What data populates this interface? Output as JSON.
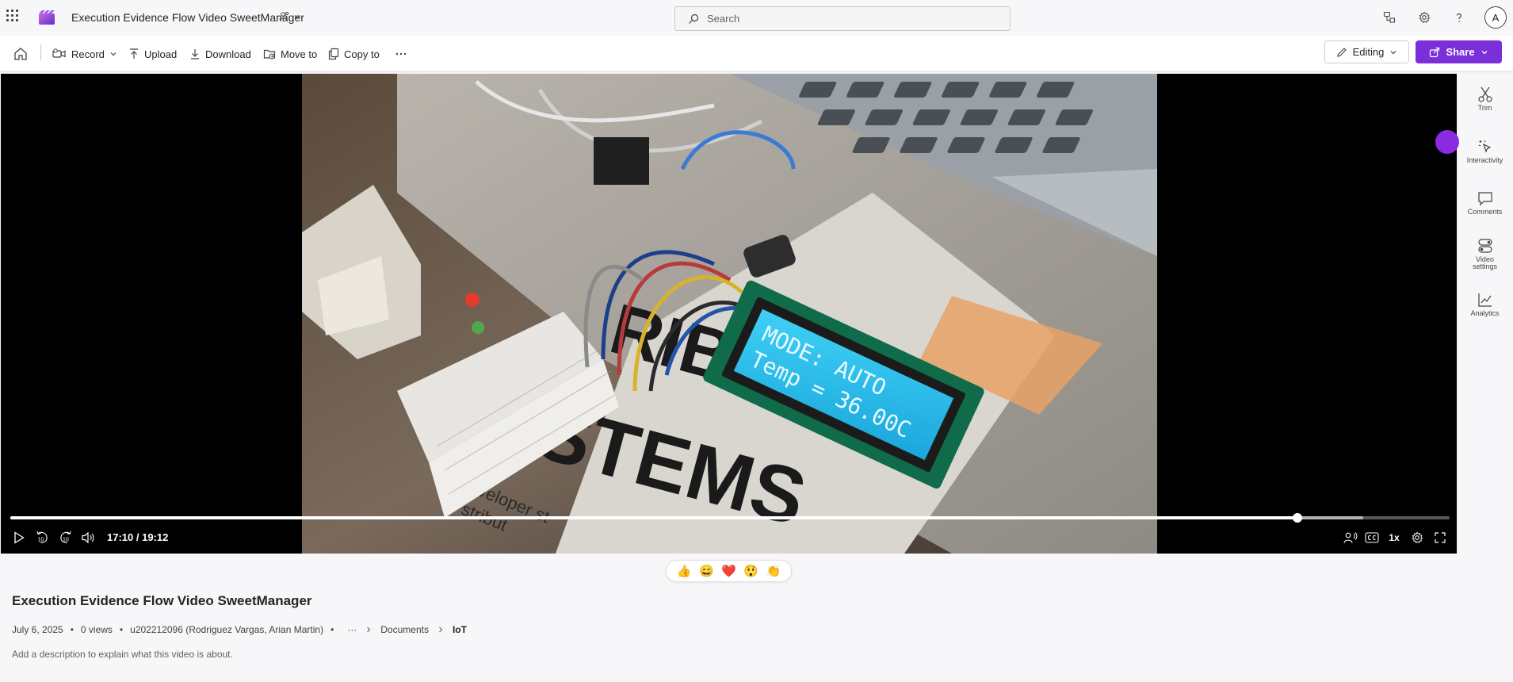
{
  "app": {
    "document_title": "Execution Evidence Flow Video SweetManager",
    "avatar_initial": "A",
    "accent_color": "#7b2fd8"
  },
  "search": {
    "placeholder": "Search"
  },
  "toolbar": {
    "record_label": "Record",
    "upload_label": "Upload",
    "download_label": "Download",
    "move_to_label": "Move to",
    "copy_to_label": "Copy to",
    "editing_label": "Editing",
    "share_label": "Share"
  },
  "player": {
    "current_time": "17:10 / 19:12",
    "progress": 0.894,
    "buffered": 0.94,
    "speed_label": "1x",
    "skip_back_label": "10",
    "skip_forward_label": "10"
  },
  "video_frame": {
    "lcd_line1": "MODE: AUTO",
    "lcd_line2": "Temp = 36.00C",
    "book_text_1": "RIBUTE",
    "book_text_2": "STEMS",
    "book_text_3": "eveloper st",
    "book_text_4": "stribut"
  },
  "rail": {
    "trim_label": "Trim",
    "interactivity_label": "Interactivity",
    "comments_label": "Comments",
    "video_settings_label": "Video settings",
    "analytics_label": "Analytics"
  },
  "reactions": [
    "👍",
    "😄",
    "❤️",
    "😲",
    "👏"
  ],
  "details": {
    "title": "Execution Evidence Flow Video SweetManager",
    "date": "July 6, 2025",
    "views": "0 views",
    "owner": "u202212096 (Rodriguez Vargas, Arian Martin)",
    "more": "···",
    "breadcrumb_1": "Documents",
    "breadcrumb_2": "IoT",
    "description_placeholder": "Add a description to explain what this video is about."
  }
}
